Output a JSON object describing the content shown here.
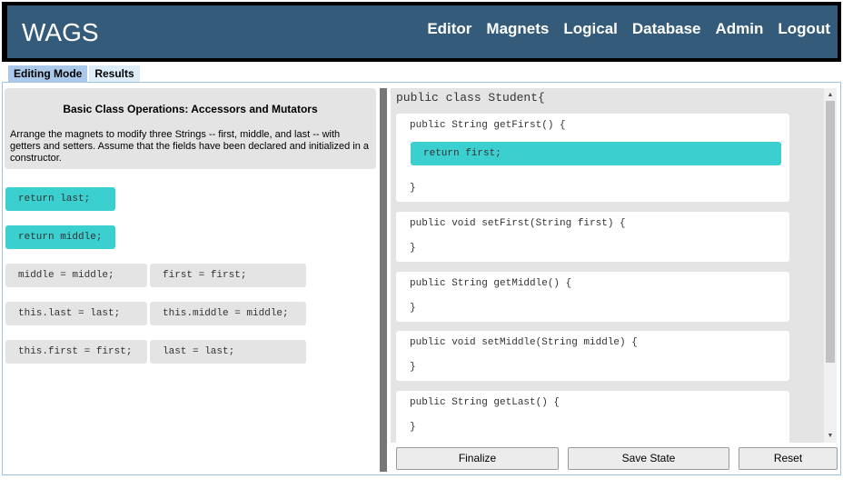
{
  "header": {
    "logo": "WAGS",
    "nav": [
      "Editor",
      "Magnets",
      "Logical",
      "Database",
      "Admin",
      "Logout"
    ]
  },
  "tabs": [
    "Editing Mode",
    "Results"
  ],
  "problem": {
    "title": "Basic Class Operations: Accessors and Mutators",
    "description": "Arrange the magnets to modify three Strings -- first, middle, and last -- with getters and setters. Assume that the fields have been declared and initialized in a constructor."
  },
  "magnets": [
    "return last;",
    "return middle;",
    "middle = middle;",
    "first = first;",
    "this.last = last;",
    "this.middle = middle;",
    "this.first = first;",
    "last = last;"
  ],
  "editor": {
    "class_decl": "public class Student{",
    "methods": [
      {
        "signature": "public String getFirst() {",
        "dropped": "return first;",
        "close": "}"
      },
      {
        "signature": "public void setFirst(String first) {",
        "close": "}"
      },
      {
        "signature": "public String getMiddle() {",
        "close": "}"
      },
      {
        "signature": "public void setMiddle(String middle) {",
        "close": "}"
      },
      {
        "signature": "public String getLast() {",
        "close": "}"
      }
    ]
  },
  "buttons": {
    "finalize": "Finalize",
    "save": "Save State",
    "reset": "Reset"
  },
  "colors": {
    "header_bg": "#345b79",
    "magnet_active": "#3ccfcf",
    "magnet_inactive": "#e4e4e4"
  }
}
